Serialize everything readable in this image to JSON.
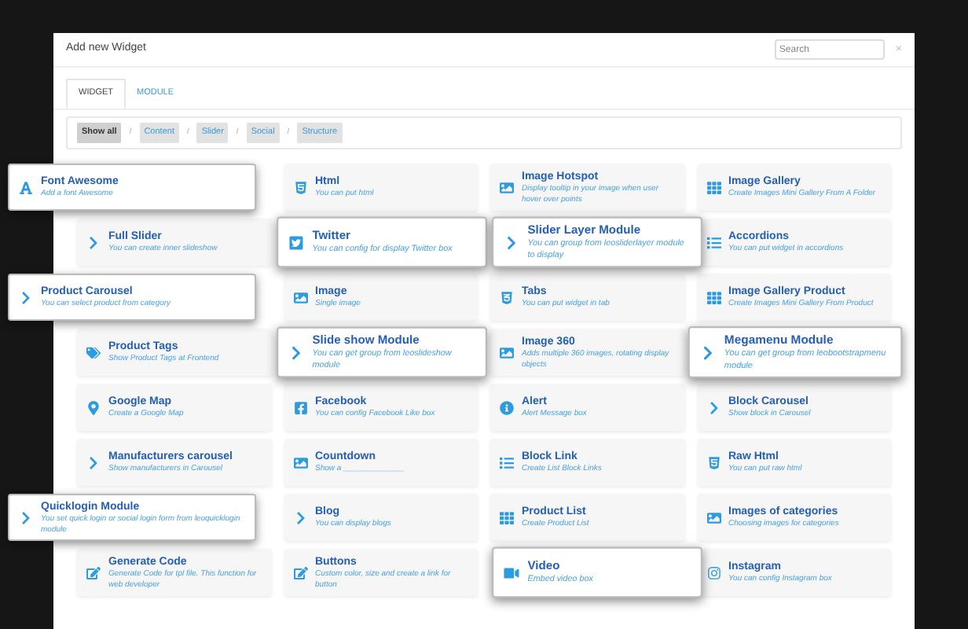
{
  "window": {
    "title": "Add new Widget",
    "close": "×"
  },
  "search": {
    "placeholder": "Search"
  },
  "tabs": [
    {
      "label": "WIDGET",
      "selected": true
    },
    {
      "label": "MODULE",
      "selected": false
    }
  ],
  "filters": [
    {
      "label": "Show all",
      "selected": true
    },
    {
      "label": "Content",
      "selected": false
    },
    {
      "label": "Slider",
      "selected": false
    },
    {
      "label": "Social",
      "selected": false
    },
    {
      "label": "Structure",
      "selected": false
    }
  ],
  "filter_separator": "/",
  "widgets": [
    {
      "title": "Font Awesome",
      "description": "Add a font Awesome",
      "raised": true
    },
    {
      "title": "Html",
      "description": "You can put html",
      "raised": false
    },
    {
      "title": "Image Hotspot",
      "description": "Display tooltip in your image when user hover over points",
      "raised": false
    },
    {
      "title": "Image Gallery",
      "description": "Create Images Mini Gallery From A Folder",
      "raised": false
    },
    {
      "title": "Full Slider",
      "description": "You can create inner slideshow",
      "raised": false
    },
    {
      "title": "Twitter",
      "description": "You can config for display Twitter box",
      "raised": true
    },
    {
      "title": "Slider Layer Module",
      "description": "You can group from leosliderlayer module to display",
      "raised": true
    },
    {
      "title": "Accordions",
      "description": "You can put widget in accordions",
      "raised": false
    },
    {
      "title": "Product Carousel",
      "description": "You can select product from category",
      "raised": true
    },
    {
      "title": "Image",
      "description": "Single image",
      "raised": false
    },
    {
      "title": "Tabs",
      "description": "You can put widget in tab",
      "raised": false
    },
    {
      "title": "Image Gallery Product",
      "description": "Create Images Mini Gallery From Product",
      "raised": false
    },
    {
      "title": "Product Tags",
      "description": "Show Product Tags at Frontend",
      "raised": false
    },
    {
      "title": "Slide show Module",
      "description": "You can get group from leoslideshow module",
      "raised": true
    },
    {
      "title": "Image 360",
      "description": "Adds multiple 360 images, rotating display objects",
      "raised": false
    },
    {
      "title": "Megamenu Module",
      "description": "You can get group from leobootstrapmenu module",
      "raised": true
    },
    {
      "title": "Google Map",
      "description": "Create a Google Map",
      "raised": false
    },
    {
      "title": "Facebook",
      "description": "You can config Facebook Like box",
      "raised": false
    },
    {
      "title": "Alert",
      "description": "Alert Message box",
      "raised": false
    },
    {
      "title": "Block Carousel",
      "description": "Show block in Carousel",
      "raised": false
    },
    {
      "title": "Manufacturers carousel",
      "description": "Show manufacturers in Carousel",
      "raised": false
    },
    {
      "title": "Countdown",
      "description": "Show a ______________",
      "raised": false
    },
    {
      "title": "Block Link",
      "description": "Create List Block Links",
      "raised": false
    },
    {
      "title": "Raw Html",
      "description": "You can put raw html",
      "raised": false
    },
    {
      "title": "Quicklogin Module",
      "description": "You set quick login or social login form from leoquicklogin module",
      "raised": true
    },
    {
      "title": "Blog",
      "description": "You can display blogs",
      "raised": false
    },
    {
      "title": "Product List",
      "description": "Create Product List",
      "raised": false
    },
    {
      "title": "Images of categories",
      "description": "Choosing images for categories",
      "raised": false
    },
    {
      "title": "Generate Code",
      "description": "Generate Code for tpl file. This function for web developer",
      "raised": false
    },
    {
      "title": "Buttons",
      "description": "Custom color, size and create a link for button",
      "raised": false
    },
    {
      "title": "Video",
      "description": "Embed video box",
      "raised": true
    },
    {
      "title": "Instagram",
      "description": "You can config Instagram box",
      "raised": false
    }
  ]
}
